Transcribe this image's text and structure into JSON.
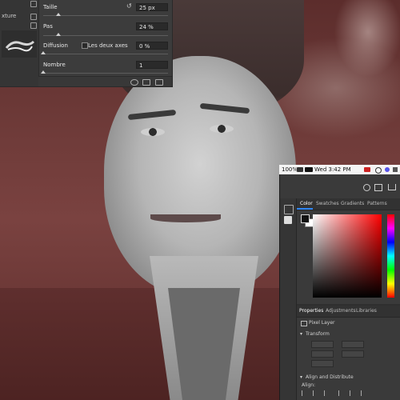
{
  "brush_panel": {
    "left_items": [
      {
        "label": ""
      },
      {
        "label": "xture"
      }
    ],
    "size": {
      "label": "Taille",
      "value": "25 px",
      "slider_fraction": 0.12
    },
    "spacing": {
      "label": "Pas",
      "value": "24 %",
      "slider_fraction": 0.12
    },
    "scatter": {
      "label": "Diffusion",
      "both_axes_label": "Les deux axes",
      "value": "0 %",
      "slider_fraction": 0.0
    },
    "count": {
      "label": "Nombre",
      "value": "1",
      "slider_fraction": 0.0
    }
  },
  "menubar": {
    "battery": "100%",
    "datetime": "Wed 3:42 PM"
  },
  "color_panel": {
    "tabs": [
      {
        "label": "Color",
        "active": true
      },
      {
        "label": "Swatches",
        "active": false
      },
      {
        "label": "Gradients",
        "active": false
      },
      {
        "label": "Patterns",
        "active": false
      }
    ],
    "foreground": "#111111",
    "background": "#ffffff"
  },
  "properties_panel": {
    "tabs": [
      {
        "label": "Properties",
        "active": true
      },
      {
        "label": "Adjustments",
        "active": false
      },
      {
        "label": "Libraries",
        "active": false
      }
    ],
    "layer_kind": "Pixel Layer",
    "transform_label": "Transform",
    "align_section": "Align and Distribute",
    "align_label": "Align:"
  },
  "colors": {
    "accent": "#2f86f3",
    "panel_bg": "#3a3a3a",
    "photo_tint": "#6b3a38"
  }
}
